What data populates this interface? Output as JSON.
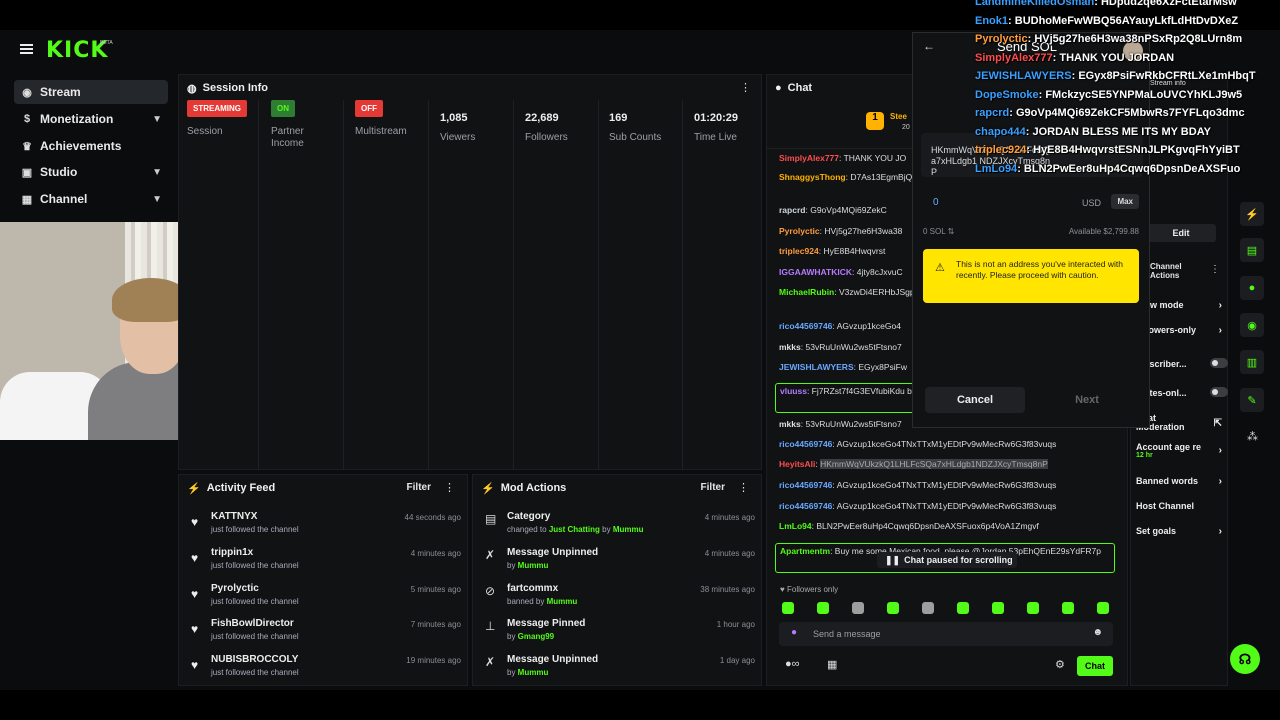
{
  "brand": {
    "logo": "KICK",
    "beta": "BETA",
    "accent": "#53fc18"
  },
  "sidebar": {
    "items": [
      {
        "label": "Stream",
        "icon": "stream-icon",
        "active": true
      },
      {
        "label": "Monetization",
        "icon": "dollar-icon",
        "chevron": true
      },
      {
        "label": "Achievements",
        "icon": "trophy-icon"
      },
      {
        "label": "Studio",
        "icon": "studio-icon",
        "chevron": true
      },
      {
        "label": "Channel",
        "icon": "channel-icon",
        "chevron": true
      }
    ]
  },
  "session": {
    "title": "Session Info",
    "stats": [
      {
        "tag": "STREAMING",
        "tag_color": "#e53935",
        "label": "Session"
      },
      {
        "tag": "ON",
        "tag_color": "#2e7d32",
        "label": "Partner Income"
      },
      {
        "tag": "OFF",
        "tag_color": "#e53935",
        "label": "Multistream"
      },
      {
        "value": "1,085",
        "label": "Viewers"
      },
      {
        "value": "22,689",
        "label": "Followers"
      },
      {
        "value": "169",
        "label": "Sub Counts"
      },
      {
        "value": "01:20:29",
        "label": "Time Live"
      }
    ]
  },
  "activity": {
    "title": "Activity Feed",
    "filter": "Filter",
    "rows": [
      {
        "name": "KATTNYX",
        "sub": "just followed the channel",
        "time": "44 seconds ago"
      },
      {
        "name": "trippin1x",
        "sub": "just followed the channel",
        "time": "4 minutes ago"
      },
      {
        "name": "Pyrolyctic",
        "sub": "just followed the channel",
        "time": "5 minutes ago"
      },
      {
        "name": "FishBowlDirector",
        "sub": "just followed the channel",
        "time": "7 minutes ago"
      },
      {
        "name": "NUBISBROCCOLY",
        "sub": "just followed the channel",
        "time": "19 minutes ago"
      }
    ]
  },
  "mod": {
    "title": "Mod Actions",
    "filter": "Filter",
    "rows": [
      {
        "icon": "category-icon",
        "glyph": "▤",
        "name": "Category",
        "pre": "changed to ",
        "hl": "Just Chatting",
        "mid": " by ",
        "user": "Mummu",
        "time": "4 minutes ago"
      },
      {
        "icon": "unpin-icon",
        "glyph": "✗",
        "name": "Message Unpinned",
        "pre": "by ",
        "user": "Mummu",
        "time": "4 minutes ago"
      },
      {
        "icon": "ban-icon",
        "glyph": "⊘",
        "name": "fartcommx",
        "pre": "banned by ",
        "user": "Mummu",
        "time": "38 minutes ago"
      },
      {
        "icon": "pin-icon",
        "glyph": "⊥",
        "name": "Message Pinned",
        "pre": "by ",
        "user": "Gmang99",
        "time": "1 hour ago"
      },
      {
        "icon": "unpin-icon",
        "glyph": "✗",
        "name": "Message Unpinned",
        "pre": "by ",
        "user": "Mummu",
        "time": "1 day ago"
      }
    ]
  },
  "chat": {
    "title": "Chat",
    "pinned_name": "Stee",
    "pinned_sub": "20",
    "lines": [
      {
        "user": "SimplyAlex777",
        "color": "#ff4d4d",
        "text": "THANK YOU JO"
      },
      {
        "user": "ShnaggysThong",
        "color": "#ffb300",
        "text": "D7As13EgmBjQk8JiD85G3BYY"
      },
      {
        "user": "rapcrd",
        "color": "#cfd8dc",
        "text": "G9oVp4MQi69ZekC"
      },
      {
        "user": "Pyrolyctic",
        "color": "#ff9c3b",
        "text": "HVj5g27he6H3wa38"
      },
      {
        "user": "triplec924",
        "color": "#ff9c3b",
        "text": "HyE8B4Hwqvrst"
      },
      {
        "user": "IGGAAWHATKICK",
        "color": "#b57bff",
        "text": "4jty8cJxvuC"
      },
      {
        "user": "MichaelRubin",
        "color": "#53fc18",
        "text": "V3zwDi4ERHbJSgpWYYMdC7g"
      },
      {
        "user": "rico44569746",
        "color": "#6aa8ff",
        "text": "AGvzup1kceGo4"
      },
      {
        "user": "mkks",
        "color": "#e0e0e0",
        "text": "53vRuUnWu2ws5tFtsno7"
      },
      {
        "user": "JEWISHLAWYERS",
        "color": "#6aa8ff",
        "text": "EGyx8PsiFw"
      },
      {
        "user": "vluuss",
        "color": "#b57bff",
        "text": "Fj7RZst7f4G3EVfubiKdu buy new socks @Jordan"
      },
      {
        "user": "mkks",
        "color": "#e0e0e0",
        "text": "53vRuUnWu2ws5tFtsno7"
      },
      {
        "user": "rico44569746",
        "color": "#6aa8ff",
        "text": "AGvzup1kceGo4TNxTTxM1yEDtPv9wMecRw6G3f83vuqs"
      },
      {
        "user": "HeyitsAli",
        "color": "#ff4d4d",
        "text": "HKmmWqVUkzkQ1LHLFcSQa7xHLdgb1NDZJXcyTmsq8nP"
      },
      {
        "user": "rico44569746",
        "color": "#6aa8ff",
        "text": "AGvzup1kceGo4TNxTTxM1yEDtPv9wMecRw6G3f83vuqs"
      },
      {
        "user": "rico44569746",
        "color": "#6aa8ff",
        "text": "AGvzup1kceGo4TNxTTxM1yEDtPv9wMecRw6G3f83vuqs"
      },
      {
        "user": "LmLo94",
        "color": "#53fc18",
        "text": "BLN2PwEer8uHp4Cqwq6DpsnDeAXSFuox6p4VoA1Zmgvf"
      },
      {
        "user": "Apartmentm",
        "color": "#53fc18",
        "text": "Buy me some Mexican food, please @Jordan 53pEhQEnE29sYdFR7p"
      }
    ],
    "paused": "Chat paused for scrolling",
    "followers_only": "Followers only",
    "placeholder": "Send a message",
    "send": "Chat"
  },
  "send_sol": {
    "title": "Send SOL",
    "address": "HKmmWqVUkzkQ1LHLFcSQa7xHLdgb1 NDZJXcyTmsq8nP",
    "amount": "0",
    "currency": "USD",
    "max": "Max",
    "sol": "0 SOL ⇅",
    "available": "Available $2,799.88",
    "warning": "This is not an address you've interacted with recently. Please proceed with caution.",
    "cancel": "Cancel",
    "next": "Next"
  },
  "right_panel": {
    "edit": "Edit",
    "channel_actions": "Channel Actions",
    "stream_info": "Stream info",
    "items": [
      {
        "label": "w mode",
        "type": "chev"
      },
      {
        "label": "lowers-only",
        "type": "chev"
      },
      {
        "label": "bscriber...",
        "type": "toggle"
      },
      {
        "label": "otes-onl...",
        "type": "toggle"
      },
      {
        "label": "Chat Moderation",
        "type": "link"
      },
      {
        "label": "Account age re",
        "sub": "12 hr",
        "type": "chev"
      },
      {
        "label": "Banned words",
        "type": "chev"
      },
      {
        "label": "Host Channel",
        "type": "none"
      },
      {
        "label": "Set goals",
        "type": "chev"
      }
    ]
  },
  "overlay_chat": [
    {
      "user": "LandmineKilledOsman",
      "color": "#3aa0ff",
      "text": "HDpud2qe6XzFctEtarMsw"
    },
    {
      "user": "Enok1",
      "color": "#3aa0ff",
      "text": "BUDhoMeFwWBQ56AYauyLkfLdHtDvDXeZ"
    },
    {
      "user": "Pyrolyctic",
      "color": "#ff9c3b",
      "text": "HVj5g27he6H3wa38nPSxRp2Q8LUrn8m"
    },
    {
      "user": "SimplyAlex777",
      "color": "#ff4d4d",
      "text": "THANK YOU JORDAN"
    },
    {
      "user": "JEWISHLAWYERS",
      "color": "#3aa0ff",
      "text": "EGyx8PsiFwRkbCFRtLXe1mHbqT"
    },
    {
      "user": "DopeSmoke",
      "color": "#3aa0ff",
      "text": "FMckzycSE5YNPMaLoUVCYhKLJ9w5"
    },
    {
      "user": "rapcrd",
      "color": "#3aa0ff",
      "text": "G9oVp4MQi69ZekCF5MbwRs7FYFLqo3dmc"
    },
    {
      "user": "chapo444",
      "color": "#3aa0ff",
      "text": "JORDAN BLESS ME ITS MY BDAY"
    },
    {
      "user": "triplec924",
      "color": "#ff9c3b",
      "text": "HyE8B4HwqvrstESNnJLPKgvqFhYyiBT"
    },
    {
      "user": "LmLo94",
      "color": "#3aa0ff",
      "text": "BLN2PwEer8uHp4Cqwq6DpsnDeAXSFuo"
    }
  ]
}
